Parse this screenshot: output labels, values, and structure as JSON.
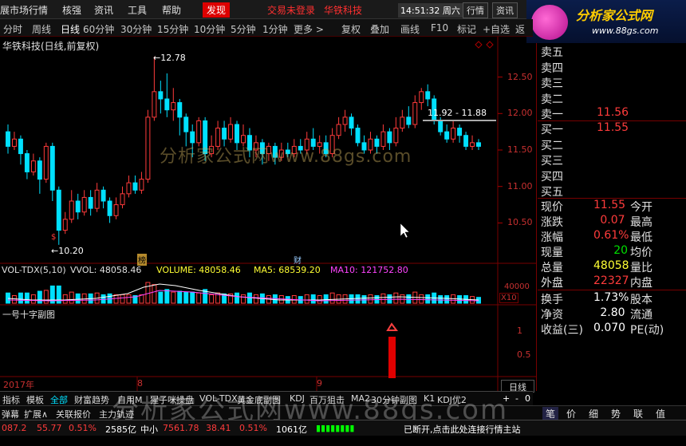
{
  "menu": {
    "items": [
      "展市场行情",
      "核强",
      "资讯",
      "工具",
      "帮助"
    ],
    "discover": "发现",
    "login_status": "交易未登录",
    "stock_name": "华铁科技",
    "clock": "14:51:32",
    "weekday": "周六",
    "btn_quote": "行情",
    "btn_news": "资讯"
  },
  "logo": {
    "title": "分析家公式网",
    "url": "www.88gs.com"
  },
  "toolbar": {
    "periods": [
      "分时",
      "周线",
      "日线",
      "60分钟",
      "30分钟",
      "15分钟",
      "10分钟",
      "5分钟",
      "1分钟",
      "更多 >"
    ],
    "active_period": "日线",
    "actions": [
      "复权",
      "叠加",
      "画线",
      "F10",
      "标记",
      "+自选",
      "返"
    ]
  },
  "chart": {
    "title": "华铁科技(日线,前复权)",
    "high_label": "12.78",
    "low_label": "10.20",
    "range_label": "11.92 - 11.88",
    "date_markers": [
      "2017年",
      "8",
      "9"
    ],
    "event_markers": [
      "榜",
      "财",
      "$"
    ],
    "watermark": "分析家公式网www.88gs.com"
  },
  "chart_data": {
    "type": "candlestick",
    "y_axis": {
      "ticks": [
        10.5,
        11.0,
        11.5,
        12.0,
        12.5
      ],
      "range": [
        10.1,
        12.9
      ]
    },
    "series": [
      {
        "open": 11.75,
        "close": 11.55,
        "high": 11.85,
        "low": 11.45
      },
      {
        "open": 11.55,
        "close": 11.65,
        "high": 11.75,
        "low": 11.5
      },
      {
        "open": 11.65,
        "close": 11.45,
        "high": 11.7,
        "low": 11.3
      },
      {
        "open": 11.45,
        "close": 11.2,
        "high": 11.5,
        "low": 11.1
      },
      {
        "open": 11.2,
        "close": 11.35,
        "high": 11.45,
        "low": 11.15
      },
      {
        "open": 11.35,
        "close": 11.1,
        "high": 11.4,
        "low": 10.9
      },
      {
        "open": 11.1,
        "close": 11.55,
        "high": 11.6,
        "low": 11.05
      },
      {
        "open": 11.55,
        "close": 10.95,
        "high": 11.6,
        "low": 10.8
      },
      {
        "open": 10.95,
        "close": 10.4,
        "high": 11.0,
        "low": 10.2
      },
      {
        "open": 10.4,
        "close": 10.55,
        "high": 10.65,
        "low": 10.35
      },
      {
        "open": 10.55,
        "close": 10.8,
        "high": 10.95,
        "low": 10.5
      },
      {
        "open": 10.8,
        "close": 10.65,
        "high": 10.9,
        "low": 10.55
      },
      {
        "open": 10.65,
        "close": 10.85,
        "high": 10.95,
        "low": 10.6
      },
      {
        "open": 10.85,
        "close": 10.7,
        "high": 10.95,
        "low": 10.6
      },
      {
        "open": 10.7,
        "close": 10.95,
        "high": 11.05,
        "low": 10.65
      },
      {
        "open": 10.95,
        "close": 10.8,
        "high": 11.0,
        "low": 10.7
      },
      {
        "open": 10.8,
        "close": 10.6,
        "high": 10.85,
        "low": 10.5
      },
      {
        "open": 10.6,
        "close": 10.75,
        "high": 10.85,
        "low": 10.55
      },
      {
        "open": 10.75,
        "close": 10.9,
        "high": 11.0,
        "low": 10.7
      },
      {
        "open": 10.9,
        "close": 11.05,
        "high": 11.15,
        "low": 10.85
      },
      {
        "open": 11.05,
        "close": 10.95,
        "high": 11.15,
        "low": 10.9
      },
      {
        "open": 10.95,
        "close": 11.1,
        "high": 11.2,
        "low": 10.9
      },
      {
        "open": 11.1,
        "close": 11.95,
        "high": 12.05,
        "low": 11.05
      },
      {
        "open": 11.95,
        "close": 12.3,
        "high": 12.78,
        "low": 11.9
      },
      {
        "open": 12.3,
        "close": 12.2,
        "high": 12.45,
        "low": 12.0
      },
      {
        "open": 12.2,
        "close": 12.05,
        "high": 12.55,
        "low": 11.95
      },
      {
        "open": 12.05,
        "close": 12.15,
        "high": 12.35,
        "low": 11.9
      },
      {
        "open": 12.15,
        "close": 11.95,
        "high": 12.2,
        "low": 11.7
      },
      {
        "open": 11.95,
        "close": 11.75,
        "high": 12.0,
        "low": 11.55
      },
      {
        "open": 11.75,
        "close": 11.6,
        "high": 11.85,
        "low": 11.4
      },
      {
        "open": 11.6,
        "close": 11.9,
        "high": 11.95,
        "low": 11.55
      },
      {
        "open": 11.9,
        "close": 11.45,
        "high": 11.95,
        "low": 11.35
      },
      {
        "open": 11.45,
        "close": 11.55,
        "high": 11.7,
        "low": 11.4
      },
      {
        "open": 11.55,
        "close": 11.8,
        "high": 11.9,
        "low": 11.5
      },
      {
        "open": 11.8,
        "close": 11.65,
        "high": 11.9,
        "low": 11.55
      },
      {
        "open": 11.65,
        "close": 11.85,
        "high": 11.95,
        "low": 11.6
      },
      {
        "open": 11.85,
        "close": 11.6,
        "high": 11.9,
        "low": 11.5
      },
      {
        "open": 11.6,
        "close": 11.7,
        "high": 11.85,
        "low": 11.55
      },
      {
        "open": 11.7,
        "close": 11.5,
        "high": 11.8,
        "low": 11.4
      },
      {
        "open": 11.5,
        "close": 11.6,
        "high": 11.7,
        "low": 11.4
      },
      {
        "open": 11.6,
        "close": 11.45,
        "high": 11.65,
        "low": 11.3
      },
      {
        "open": 11.45,
        "close": 11.55,
        "high": 11.6,
        "low": 11.35
      },
      {
        "open": 11.55,
        "close": 11.4,
        "high": 11.6,
        "low": 11.3
      },
      {
        "open": 11.4,
        "close": 11.5,
        "high": 11.6,
        "low": 11.35
      },
      {
        "open": 11.5,
        "close": 11.45,
        "high": 11.6,
        "low": 11.4
      },
      {
        "open": 11.45,
        "close": 11.55,
        "high": 11.65,
        "low": 11.4
      },
      {
        "open": 11.55,
        "close": 11.5,
        "high": 11.65,
        "low": 11.45
      },
      {
        "open": 11.5,
        "close": 11.65,
        "high": 11.75,
        "low": 11.45
      },
      {
        "open": 11.65,
        "close": 11.55,
        "high": 11.8,
        "low": 11.5
      },
      {
        "open": 11.55,
        "close": 11.6,
        "high": 11.7,
        "low": 11.45
      },
      {
        "open": 11.6,
        "close": 11.45,
        "high": 11.7,
        "low": 11.4
      },
      {
        "open": 11.45,
        "close": 11.7,
        "high": 11.8,
        "low": 11.4
      },
      {
        "open": 11.7,
        "close": 11.85,
        "high": 11.95,
        "low": 11.65
      },
      {
        "open": 11.85,
        "close": 11.95,
        "high": 12.05,
        "low": 11.75
      },
      {
        "open": 11.95,
        "close": 11.8,
        "high": 12.0,
        "low": 11.7
      },
      {
        "open": 11.8,
        "close": 11.6,
        "high": 11.85,
        "low": 11.55
      },
      {
        "open": 11.6,
        "close": 11.5,
        "high": 11.7,
        "low": 11.45
      },
      {
        "open": 11.5,
        "close": 11.65,
        "high": 11.75,
        "low": 11.45
      },
      {
        "open": 11.65,
        "close": 11.55,
        "high": 11.7,
        "low": 11.45
      },
      {
        "open": 11.55,
        "close": 11.75,
        "high": 11.85,
        "low": 11.5
      },
      {
        "open": 11.75,
        "close": 11.6,
        "high": 11.8,
        "low": 11.5
      },
      {
        "open": 11.6,
        "close": 11.8,
        "high": 11.95,
        "low": 11.55
      },
      {
        "open": 11.8,
        "close": 11.95,
        "high": 12.05,
        "low": 11.75
      },
      {
        "open": 11.95,
        "close": 11.85,
        "high": 12.1,
        "low": 11.8
      },
      {
        "open": 11.85,
        "close": 12.15,
        "high": 12.25,
        "low": 11.8
      },
      {
        "open": 12.15,
        "close": 12.3,
        "high": 12.35,
        "low": 12.05
      },
      {
        "open": 12.3,
        "close": 12.2,
        "high": 12.4,
        "low": 12.1
      },
      {
        "open": 12.2,
        "close": 11.9,
        "high": 12.25,
        "low": 11.85
      },
      {
        "open": 11.9,
        "close": 11.75,
        "high": 11.95,
        "low": 11.7
      },
      {
        "open": 11.75,
        "close": 11.65,
        "high": 11.85,
        "low": 11.6
      },
      {
        "open": 11.65,
        "close": 11.8,
        "high": 11.9,
        "low": 11.6
      },
      {
        "open": 11.8,
        "close": 11.7,
        "high": 11.85,
        "low": 11.6
      },
      {
        "open": 11.7,
        "close": 11.55,
        "high": 11.75,
        "low": 11.5
      },
      {
        "open": 11.55,
        "close": 11.6,
        "high": 11.7,
        "low": 11.5
      },
      {
        "open": 11.6,
        "close": 11.55,
        "high": 11.65,
        "low": 11.5
      }
    ],
    "volume_axis_label": "40000",
    "volume_unit": "X10",
    "sub_axis_ticks": [
      1.0,
      0.5
    ]
  },
  "volume": {
    "indicator": "VOL-TDX(5,10)",
    "vvol": "VVOL: 48058.46",
    "volume": "VOLUME: 48058.46",
    "ma5": "MA5: 68539.20",
    "ma10": "MA10: 121752.80"
  },
  "subchart": {
    "title": "一号十字副图"
  },
  "order_book": {
    "asks": [
      {
        "label": "卖五",
        "price": "",
        "vol": ""
      },
      {
        "label": "卖四",
        "price": "",
        "vol": ""
      },
      {
        "label": "卖三",
        "price": "",
        "vol": ""
      },
      {
        "label": "卖二",
        "price": "",
        "vol": ""
      },
      {
        "label": "卖一",
        "price": "11.56",
        "vol": ""
      }
    ],
    "bids": [
      {
        "label": "买一",
        "price": "11.55",
        "vol": ""
      },
      {
        "label": "买二",
        "price": "",
        "vol": ""
      },
      {
        "label": "买三",
        "price": "",
        "vol": ""
      },
      {
        "label": "买四",
        "price": "",
        "vol": ""
      },
      {
        "label": "买五",
        "price": "",
        "vol": ""
      }
    ]
  },
  "quote": [
    {
      "l1": "现价",
      "v1": "11.55",
      "c1": "red",
      "l2": "今开"
    },
    {
      "l1": "涨跌",
      "v1": "0.07",
      "c1": "red",
      "l2": "最高"
    },
    {
      "l1": "涨幅",
      "v1": "0.61%",
      "c1": "red",
      "l2": "最低"
    },
    {
      "l1": "现量",
      "v1": "20",
      "c1": "green",
      "l2": "均价"
    },
    {
      "l1": "总量",
      "v1": "48058",
      "c1": "yellow",
      "l2": "量比"
    },
    {
      "l1": "外盘",
      "v1": "22327",
      "c1": "red",
      "l2": "内盘"
    }
  ],
  "fundamentals": [
    {
      "l1": "换手",
      "v1": "1.73%",
      "l2": "股本"
    },
    {
      "l1": "净资",
      "v1": "2.80",
      "l2": "流通"
    },
    {
      "l1": "收益(三)",
      "v1": "0.070",
      "l2": "PE(动)"
    }
  ],
  "tabs": {
    "items": [
      "指标",
      "模板",
      "全部",
      "财富趋势",
      "自用M",
      "猩子咪操盘",
      "VOL-TDX",
      "黄金底副图",
      "KDJ",
      "百万狙击",
      "MA2",
      "30分钟副图",
      "K1",
      "KDJ优2"
    ],
    "selected": "全部",
    "daily": "日线"
  },
  "tabs2": {
    "items": [
      "弹幕",
      "扩展∧",
      "关联报价",
      "主力轨迹"
    ]
  },
  "watermark2": "分析家公式网www.88gs.com",
  "status": {
    "idx1": "087.2",
    "idx1_chg": "55.77",
    "idx1_pct": "0.51%",
    "amount1": "2585亿",
    "idx2_label": "中小",
    "idx2": "7561.78",
    "idx2_chg": "38.41",
    "idx2_pct": "0.51%",
    "amount2": "1061亿",
    "message": "已断开,点击此处连接行情主站"
  },
  "right_tabs": [
    "笔",
    "价",
    "细",
    "势",
    "联",
    "值"
  ],
  "colors": {
    "up": "#ff3b3b",
    "down": "#00e0ff",
    "bg": "#000000",
    "grid": "#700000"
  }
}
